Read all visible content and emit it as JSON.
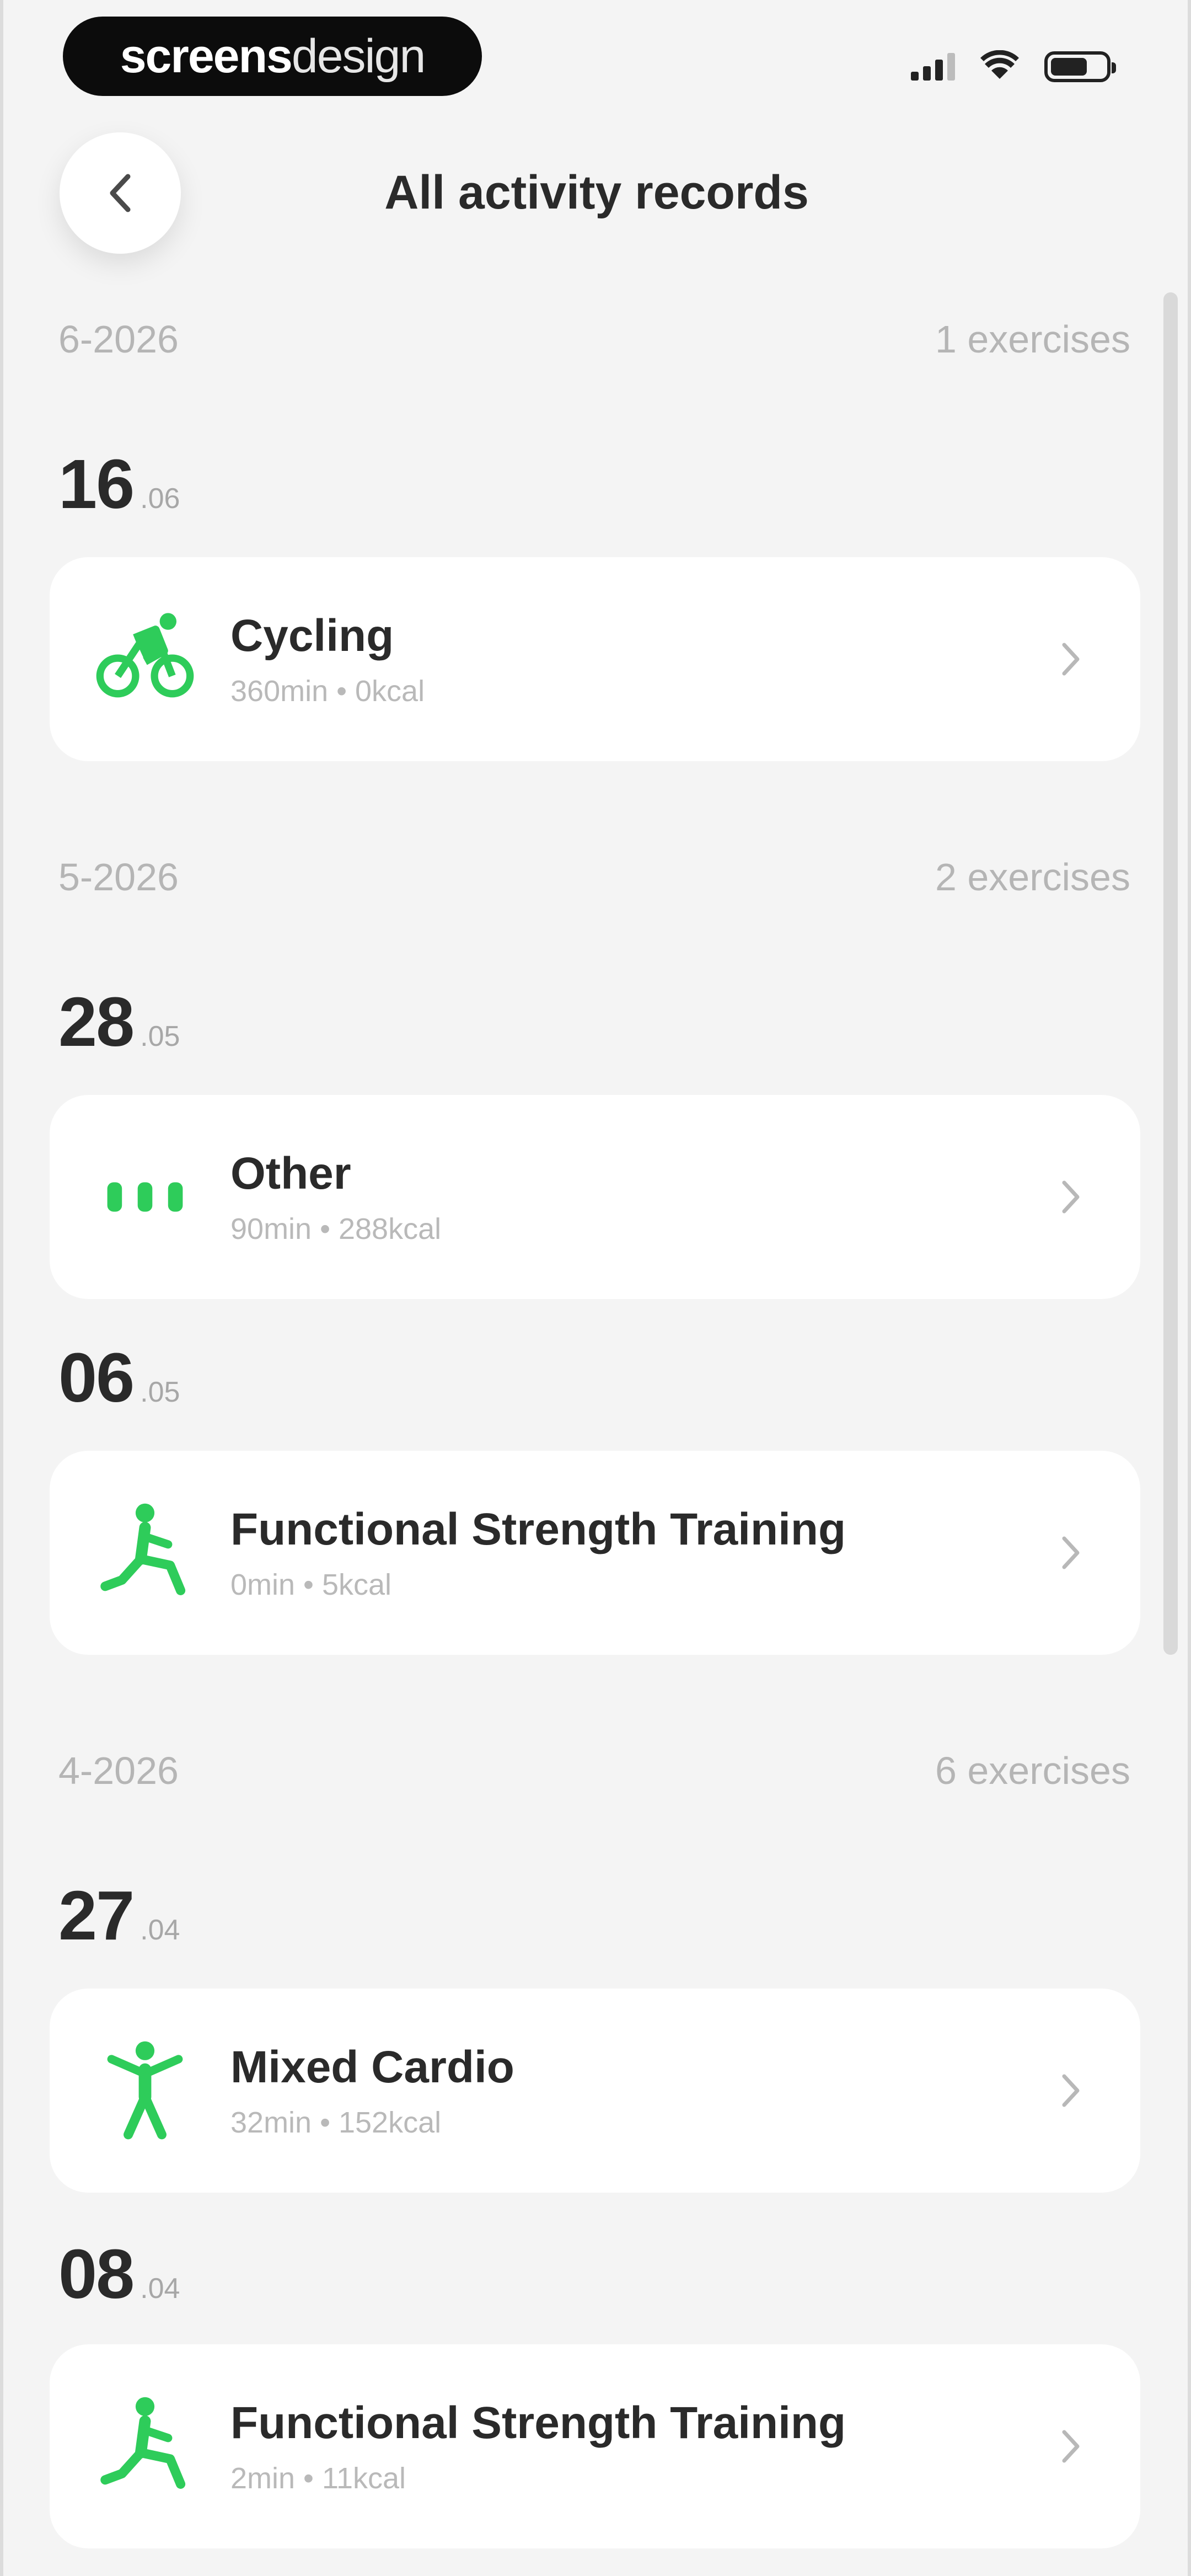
{
  "status_bar": {
    "brand_bold": "screens",
    "brand_light": "design"
  },
  "header": {
    "title": "All activity records"
  },
  "months": [
    {
      "label": "6-2026",
      "count": "1 exercises"
    },
    {
      "label": "5-2026",
      "count": "2 exercises"
    },
    {
      "label": "4-2026",
      "count": "6 exercises"
    }
  ],
  "days": [
    {
      "day": "16",
      "month": ".06"
    },
    {
      "day": "28",
      "month": ".05"
    },
    {
      "day": "06",
      "month": ".05"
    },
    {
      "day": "27",
      "month": ".04"
    },
    {
      "day": "08",
      "month": ".04"
    }
  ],
  "records": [
    {
      "title": "Cycling",
      "detail": "360min • 0kcal",
      "icon": "cycling-icon"
    },
    {
      "title": "Other",
      "detail": "90min • 288kcal",
      "icon": "dots-icon"
    },
    {
      "title": "Functional Strength Training",
      "detail": "0min • 5kcal",
      "icon": "strength-training-icon"
    },
    {
      "title": "Mixed Cardio",
      "detail": "32min • 152kcal",
      "icon": "mixed-cardio-icon"
    },
    {
      "title": "Functional Strength Training",
      "detail": "2min • 11kcal",
      "icon": "strength-training-icon"
    }
  ],
  "colors": {
    "accent": "#2ecc5a",
    "background": "#f4f4f4",
    "card": "#ffffff"
  }
}
